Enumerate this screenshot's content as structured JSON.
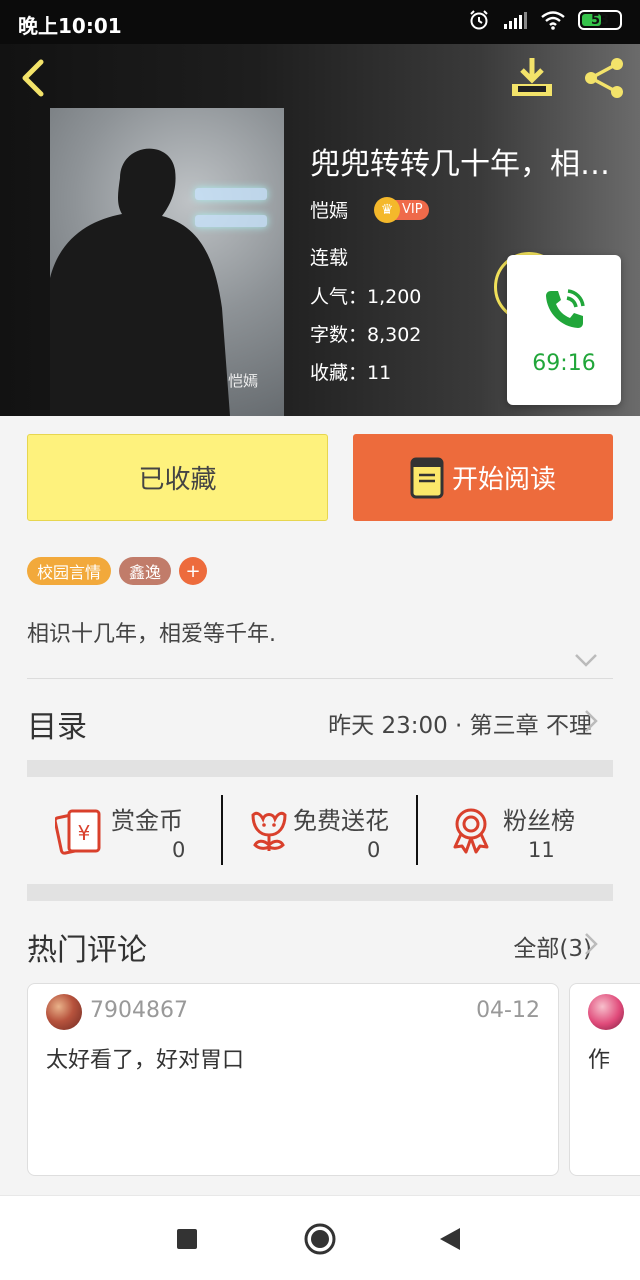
{
  "status_bar": {
    "time": "晚上10:01",
    "battery": "53",
    "battery_level": 0.53
  },
  "header": {
    "cover_signature": "恺嫣",
    "title": "兜兜转转几十年，相爱...",
    "author": "恺嫣",
    "vip_label": "VIP",
    "status": "连载",
    "popularity": "人气：1,200",
    "word_count": "字数：8,302",
    "favorites": "收藏：11"
  },
  "call_overlay": {
    "timer": "69:16",
    "color": "#21a63a"
  },
  "actions": {
    "collected_label": "已收藏",
    "read_label": "开始阅读"
  },
  "tags": [
    {
      "label": "校园言情",
      "color": "#f2a93b"
    },
    {
      "label": "鑫逸",
      "color": "#c17c6a"
    }
  ],
  "tag_add": "+",
  "summary": "相识十几年，相爱等千年.",
  "catalog": {
    "title": "目录",
    "latest": "昨天 23:00 · 第三章 不理"
  },
  "metrics": [
    {
      "label": "赏金币",
      "value": "0",
      "icon": "red-envelope-icon"
    },
    {
      "label": "免费送花",
      "value": "0",
      "icon": "flower-icon"
    },
    {
      "label": "粉丝榜",
      "value": "11",
      "icon": "medal-icon"
    }
  ],
  "comments": {
    "title": "热门评论",
    "all_label": "全部(3)",
    "items": [
      {
        "user": "7904867",
        "date": "04-12",
        "text": "太好看了，好对胃口"
      },
      {
        "user": "",
        "date": "",
        "text": "作"
      }
    ]
  },
  "colors": {
    "accent_orange": "#ed6b3c",
    "collected_yellow": "#fef27d",
    "icon_red": "#d9402c"
  }
}
